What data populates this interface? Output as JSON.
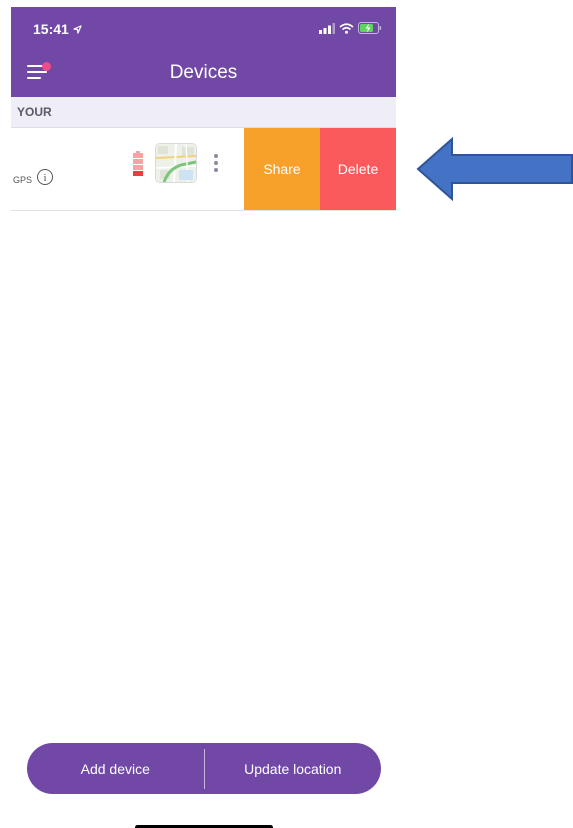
{
  "status_bar": {
    "time": "15:41",
    "icons": [
      "location-arrow-icon",
      "signal-icon",
      "wifi-icon",
      "battery-charging-icon"
    ]
  },
  "header": {
    "title": "Devices",
    "menu_icon": "hamburger-menu-icon",
    "has_notification": true
  },
  "section": {
    "label": "YOUR"
  },
  "device": {
    "name_visible": "GPS",
    "info_icon_glyph": "i",
    "battery_level": 0.2,
    "actions": {
      "share_label": "Share",
      "delete_label": "Delete"
    }
  },
  "bottom_bar": {
    "add_label": "Add device",
    "update_label": "Update location"
  },
  "colors": {
    "primary": "#7148a6",
    "share": "#f8a12a",
    "delete": "#fb5a5d",
    "section_bg": "#efedf6",
    "annotation_arrow": "#4472c4"
  }
}
